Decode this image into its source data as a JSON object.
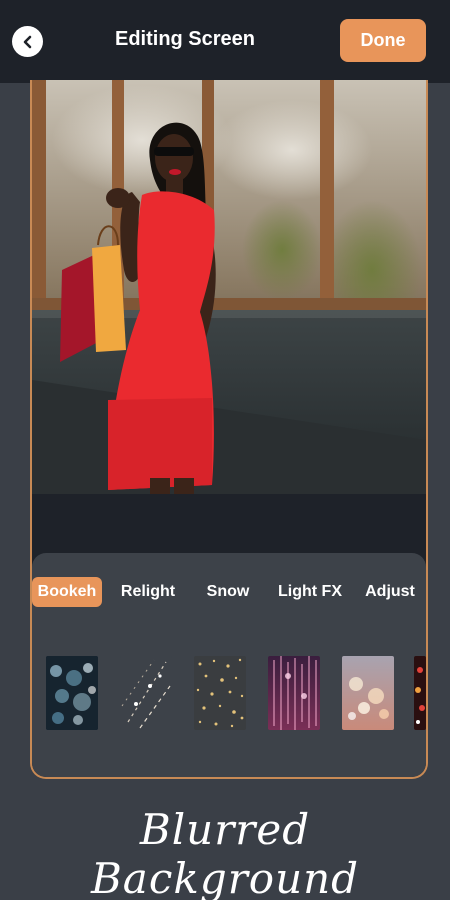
{
  "header": {
    "back_icon": "back-arrow-icon",
    "title": "Editing Screen",
    "done_label": "Done"
  },
  "colors": {
    "accent": "#e8955a",
    "background": "#3a3f47",
    "topbar": "#1e2229",
    "panel": "#3d4249",
    "frame_border": "#c88a55"
  },
  "editor": {
    "tabs": [
      {
        "label": "Bookeh",
        "active": true
      },
      {
        "label": "Relight",
        "active": false
      },
      {
        "label": "Snow",
        "active": false
      },
      {
        "label": "Light FX",
        "active": false
      },
      {
        "label": "Adjust",
        "active": false
      }
    ],
    "effect_thumbnails": [
      "bokeh-blue-thumbnail",
      "bokeh-diagonal-thumbnail",
      "bokeh-gold-dots-thumbnail",
      "bokeh-pink-streaks-thumbnail",
      "bokeh-soft-lights-thumbnail",
      "bokeh-red-partial-thumbnail"
    ]
  },
  "caption": "Blurred Background"
}
